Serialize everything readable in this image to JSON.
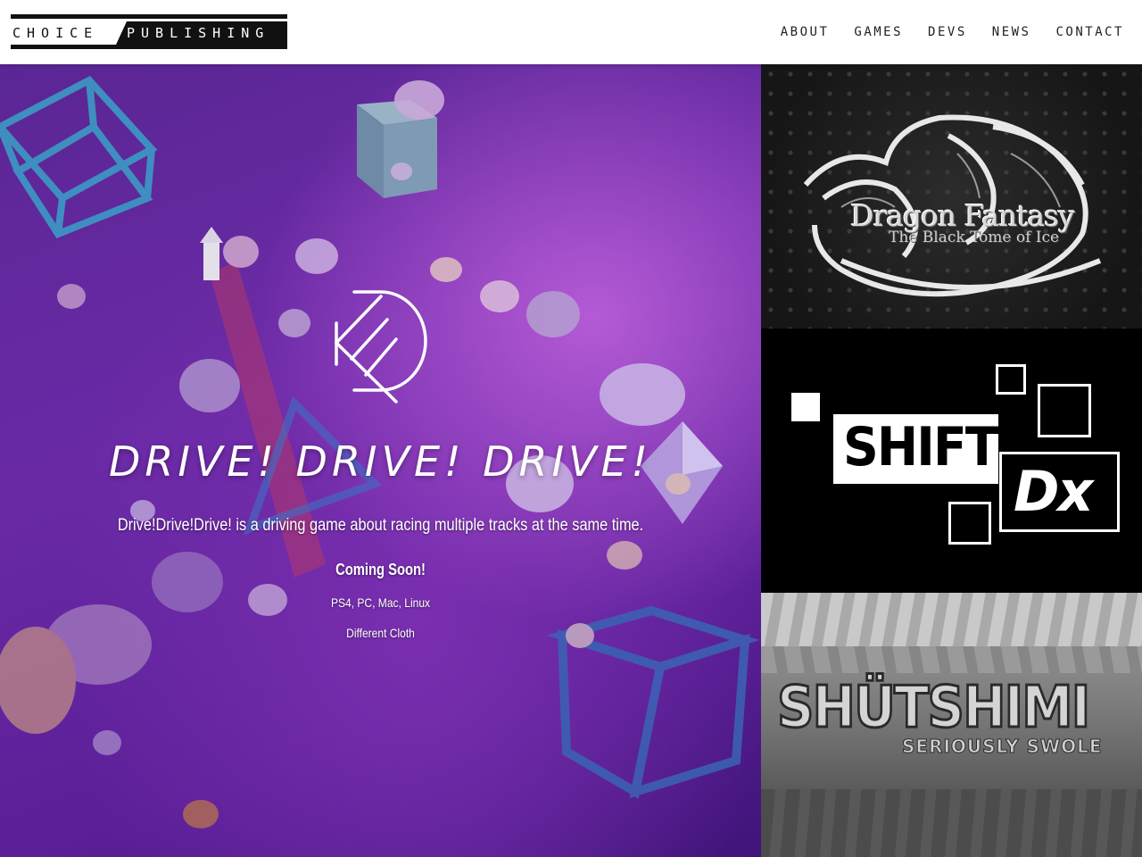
{
  "header": {
    "logo": {
      "word_left": "CHOICE",
      "word_right": "PUBLISHING"
    },
    "nav": [
      "ABOUT",
      "GAMES",
      "DEVS",
      "NEWS",
      "CONTACT"
    ]
  },
  "hero": {
    "title": "DRIVE! DRIVE! DRIVE!",
    "description": "Drive!Drive!Drive! is a driving game about racing multiple tracks at the same time.",
    "status": "Coming Soon!",
    "platforms": "PS4, PC, Mac, Linux",
    "developer": "Different Cloth",
    "logo_icon": "d-monogram-icon"
  },
  "tiles": {
    "dragon": {
      "title": "Dragon Fantasy",
      "subtitle": "The Black Tome of Ice"
    },
    "shift": {
      "title": "SHIFT",
      "suffix": "Dx"
    },
    "shuu": {
      "title": "SHÜTSHIMI",
      "subtitle": "SERIOUSLY SWOLE"
    }
  },
  "colors": {
    "hero_purple": "#6a2aa6",
    "header_bg": "#ffffff",
    "text_dark": "#222222"
  }
}
